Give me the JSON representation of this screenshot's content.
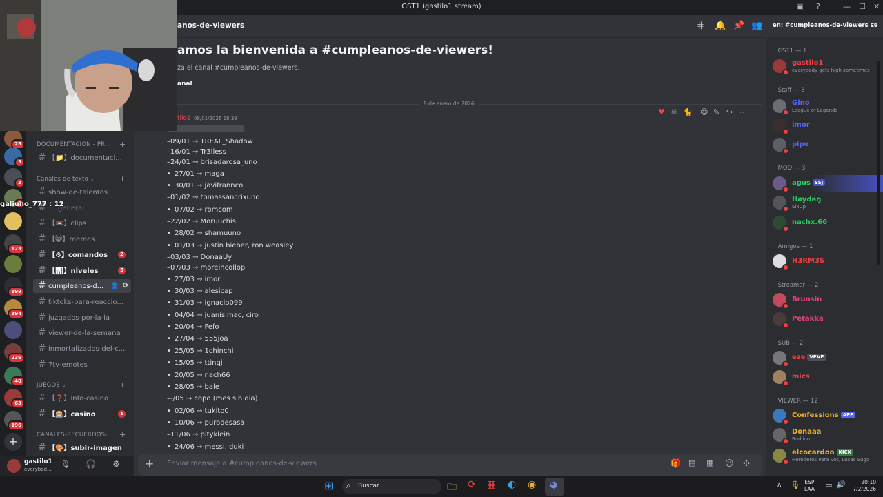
{
  "window": {
    "title": "GST1 (gastilo1 stream)"
  },
  "servers": [
    {
      "badge": "25"
    },
    {
      "badge": "3"
    },
    {
      "badge": "3"
    },
    {
      "badge": "3"
    },
    {
      "badge": ""
    },
    {
      "badge": "123"
    },
    {
      "badge": ""
    },
    {
      "badge": "199"
    },
    {
      "badge": "394"
    },
    {
      "badge": ""
    },
    {
      "badge": "236"
    },
    {
      "badge": "40"
    },
    {
      "badge": "63"
    },
    {
      "badge": "196"
    }
  ],
  "sidebar": {
    "categories": {
      "docs": "DOCUMENTACION - PR...",
      "text": "Canales de texto",
      "games": "JUEGOS",
      "recuerdos": "CANALES-RECUERDOS-..."
    },
    "channels": {
      "documentacion": "【📁】documentaci...",
      "show": "show-de-talentos",
      "general": "general",
      "clips": "【📼】clips",
      "memes": "【😸】memes",
      "comandos": "【⚙】comandos",
      "niveles": "【📊】niveles",
      "cumple": "cumpleanos-d...",
      "tiktoks": "tiktoks-para-reaccio...",
      "juzgados": "juzgados-por-la-ia",
      "viewer": "viewer-de-la-semana",
      "inmortal": "inmortalizados-del-c...",
      "7tv": "7tv-emotes",
      "infocasino": "【❓】info-casino",
      "casino": "【🎰】casino",
      "subir": "【🎨】subir-imagen"
    },
    "badges": {
      "comandos": "2",
      "niveles": "5",
      "casino": "1"
    },
    "overlay_user": "galiuno_777 : 12"
  },
  "user_panel": {
    "name": "gastilo1",
    "status": "everybod..."
  },
  "channel_header": {
    "name": "anos-de-viewers",
    "search": "en: #cumpleanos-de-viewers",
    "search_suffix": "se"
  },
  "welcome": {
    "title": "amos la bienvenida a #cumpleanos-de-viewers!",
    "subtitle": "za el canal #cumpleanos-de-viewers.",
    "button": "anal"
  },
  "date_divider": "8 de enero de 2026",
  "message": {
    "author": "tilo1",
    "timestamp": "08/01/2026 18:39",
    "lines": [
      {
        "bullet": false,
        "text": "–09/01 → TREAL_Shadow"
      },
      {
        "bullet": false,
        "text": "–16/01 → Tr3lless"
      },
      {
        "bullet": false,
        "text": "–24/01 → brisadarosa_uno"
      },
      {
        "bullet": true,
        "text": "27/01 → maga"
      },
      {
        "bullet": true,
        "text": "30/01 → javifrannco"
      },
      {
        "bullet": false,
        "text": "–01/02 → tomassancrixuno"
      },
      {
        "bullet": true,
        "text": "07/02 → romcom"
      },
      {
        "bullet": false,
        "text": "–22/02 → Moruuchis"
      },
      {
        "bullet": true,
        "text": "28/02 → shamuuno"
      },
      {
        "bullet": true,
        "text": "01/03 → justin bieber, ron weasley"
      },
      {
        "bullet": false,
        "text": "–03/03 → DonaaUy"
      },
      {
        "bullet": false,
        "text": "–07/03 → moreincollop"
      },
      {
        "bullet": true,
        "text": "27/03 → imor"
      },
      {
        "bullet": true,
        "text": "30/03 → alesicap"
      },
      {
        "bullet": true,
        "text": "31/03 → ignacio099"
      },
      {
        "bullet": true,
        "text": "04/04 → juanisimac, ciro"
      },
      {
        "bullet": true,
        "text": "20/04 → Fefo"
      },
      {
        "bullet": true,
        "text": "27/04 → 555joa"
      },
      {
        "bullet": true,
        "text": "25/05 → 1chinchi"
      },
      {
        "bullet": true,
        "text": "15/05 → ttinqj"
      },
      {
        "bullet": true,
        "text": "20/05 → nach66"
      },
      {
        "bullet": true,
        "text": "28/05 → bale"
      },
      {
        "bullet": false,
        "text": "–-/05 → copo (mes sin dia)"
      },
      {
        "bullet": true,
        "text": "02/06 → tukito0"
      },
      {
        "bullet": true,
        "text": "10/06 → purodesasa"
      },
      {
        "bullet": false,
        "text": "–11/06 → pityklein"
      },
      {
        "bullet": true,
        "text": "24/06 → messi, duki"
      }
    ]
  },
  "input": {
    "placeholder": "Enviar mensaje a #cumpleanos-de-viewers"
  },
  "members": {
    "groups": {
      "gst1": "| GST1 — 1",
      "staff": "| Staff — 3",
      "mod": "| MOD — 3",
      "amigos": "| Amigos — 1",
      "streamer": "| Streamer — 2",
      "sub": "| SUB — 2",
      "viewer": "| VIEWER — 12"
    },
    "list": [
      {
        "name": "gastilo1",
        "sub": "everybody gets high sometimes",
        "color": "#f23f43"
      },
      {
        "name": "Gino",
        "sub": "League of Legends",
        "color": "#5865f2"
      },
      {
        "name": "imor",
        "sub": "",
        "color": "#5865f2"
      },
      {
        "name": "pipe",
        "sub": "",
        "color": "#5865f2"
      },
      {
        "name": "agus",
        "sub": "",
        "color": "#23d160",
        "tag": "SSJ"
      },
      {
        "name": "Haydeŋ",
        "sub": "SixUp",
        "color": "#23d160"
      },
      {
        "name": "nachx.66",
        "sub": "",
        "color": "#23d160"
      },
      {
        "name": "H3RM3S",
        "sub": "",
        "color": "#f23f43"
      },
      {
        "name": "Brunsin",
        "sub": "",
        "color": "#e8457a"
      },
      {
        "name": "Petakka",
        "sub": "",
        "color": "#e8457a"
      },
      {
        "name": "eze",
        "sub": "",
        "color": "#f23f43",
        "tag": "VPVP"
      },
      {
        "name": "mics",
        "sub": "",
        "color": "#f23f43"
      },
      {
        "name": "Confessions",
        "sub": "",
        "color": "#f0b232",
        "tag": "APP"
      },
      {
        "name": "Donaaa",
        "sub": "Badlion",
        "color": "#f0b232"
      },
      {
        "name": "elcocardoo",
        "sub": "Herederos Para Vos, Lucas Sugo",
        "color": "#f0b232",
        "tag": "KICK"
      }
    ]
  },
  "taskbar": {
    "search": "Buscar",
    "lang": "ESP",
    "lang2": "LAA",
    "time": "20:10",
    "date": "7/2/2026"
  }
}
